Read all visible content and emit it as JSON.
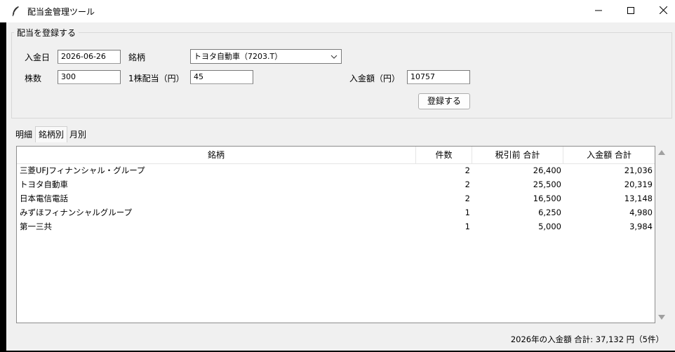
{
  "window": {
    "title": "配当金管理ツール",
    "app_icon": "feather-icon",
    "minimize_icon": "minimize-icon",
    "maximize_icon": "maximize-icon",
    "close_icon": "close-icon"
  },
  "form": {
    "legend": "配当を登録する",
    "date_label": "入金日",
    "date_value": "2026-06-26",
    "stock_label": "銘柄",
    "stock_selected": "トヨタ自動車（7203.T）",
    "shares_label": "株数",
    "shares_value": "300",
    "per_share_label": "1株配当（円）",
    "per_share_value": "45",
    "amount_label": "入金額（円）",
    "amount_value": "10757",
    "submit_label": "登録する"
  },
  "tabs": [
    {
      "label": "明細",
      "active": false
    },
    {
      "label": "銘柄別",
      "active": true
    },
    {
      "label": "月別",
      "active": false
    }
  ],
  "table": {
    "headers": [
      "銘柄",
      "件数",
      "税引前 合計",
      "入金額 合計"
    ],
    "rows": [
      [
        "三菱UFJフィナンシャル・グループ",
        "2",
        "26,400",
        "21,036"
      ],
      [
        "トヨタ自動車",
        "2",
        "25,500",
        "20,319"
      ],
      [
        "日本電信電話",
        "2",
        "16,500",
        "13,148"
      ],
      [
        "みずほフィナンシャルグループ",
        "1",
        "6,250",
        "4,980"
      ],
      [
        "第一三共",
        "1",
        "5,000",
        "3,984"
      ]
    ]
  },
  "status_text": "2026年の入金額 合計: 37,132 円（5件）",
  "colors": {
    "window_bg": "#f0f0f0",
    "titlebar_bg": "#ffffff",
    "field_border": "#7a7a7a"
  }
}
